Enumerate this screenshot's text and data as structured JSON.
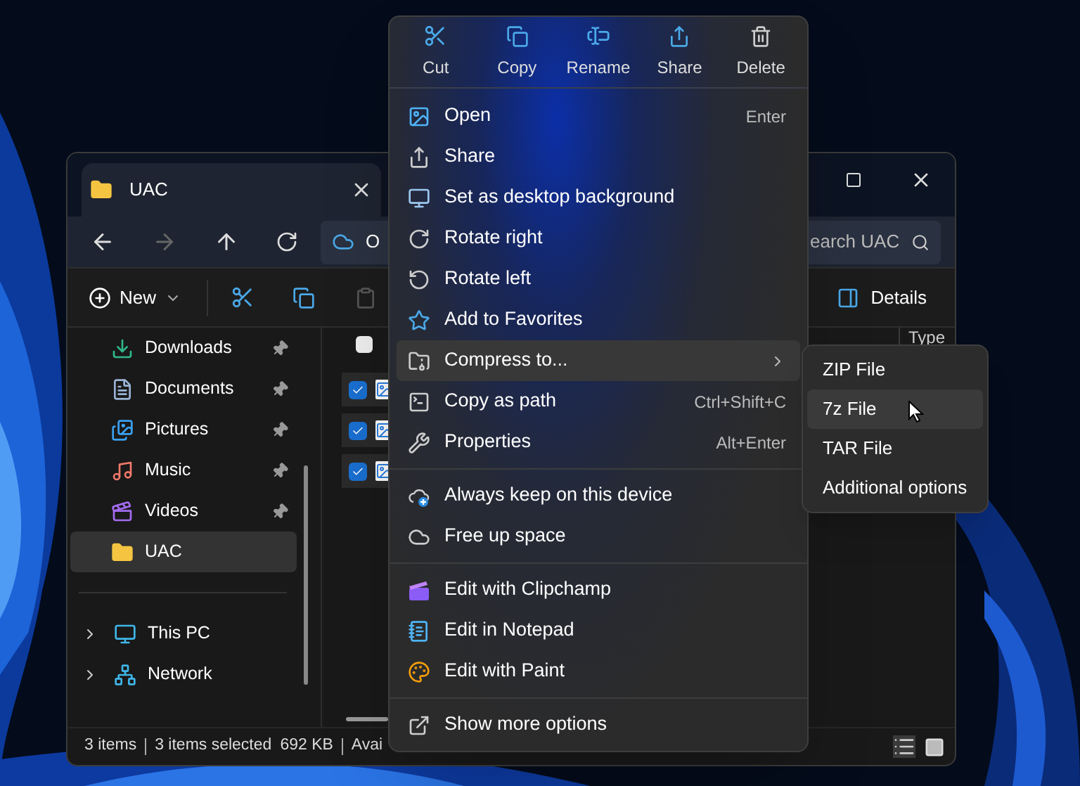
{
  "explorer": {
    "tab": {
      "title": "UAC"
    },
    "address": {
      "text": "O"
    },
    "search": {
      "placeholder": "earch UAC"
    },
    "toolbar": {
      "new_label": "New",
      "details_label": "Details"
    },
    "sidebar": {
      "items": [
        {
          "label": "Downloads",
          "pinned": true,
          "selected": false
        },
        {
          "label": "Documents",
          "pinned": true,
          "selected": false
        },
        {
          "label": "Pictures",
          "pinned": true,
          "selected": false
        },
        {
          "label": "Music",
          "pinned": true,
          "selected": false
        },
        {
          "label": "Videos",
          "pinned": true,
          "selected": false
        },
        {
          "label": "UAC",
          "pinned": false,
          "selected": true
        }
      ],
      "locations": [
        {
          "label": "This PC",
          "expanded": false
        },
        {
          "label": "Network",
          "expanded": false
        }
      ]
    },
    "file_list": {
      "header_checked": false,
      "column_type": "Type",
      "rows": [
        {
          "checked": true
        },
        {
          "checked": true
        },
        {
          "checked": true
        }
      ]
    },
    "status_bar": {
      "count": "3 items",
      "selection": "3 items selected",
      "size": "692 KB",
      "available": "Avai"
    }
  },
  "context_menu": {
    "actions": [
      {
        "label": "Cut"
      },
      {
        "label": "Copy"
      },
      {
        "label": "Rename"
      },
      {
        "label": "Share"
      },
      {
        "label": "Delete"
      }
    ],
    "groups": [
      {
        "items": [
          {
            "kind": "command",
            "label": "Open",
            "shortcut": "Enter",
            "selected": false
          },
          {
            "kind": "command",
            "label": "Share",
            "selected": false
          },
          {
            "kind": "command",
            "label": "Set as desktop background",
            "selected": false
          },
          {
            "kind": "command",
            "label": "Rotate right",
            "selected": false
          },
          {
            "kind": "command",
            "label": "Rotate left",
            "selected": false
          },
          {
            "kind": "command",
            "label": "Add to Favorites",
            "selected": false
          },
          {
            "kind": "submenu",
            "label": "Compress to...",
            "selected": true
          },
          {
            "kind": "command",
            "label": "Copy as path",
            "shortcut": "Ctrl+Shift+C",
            "selected": false
          },
          {
            "kind": "command",
            "label": "Properties",
            "shortcut": "Alt+Enter",
            "selected": false
          }
        ]
      },
      {
        "items": [
          {
            "kind": "command",
            "label": "Always keep on this device",
            "selected": false
          },
          {
            "kind": "command",
            "label": "Free up space",
            "selected": false
          }
        ]
      },
      {
        "items": [
          {
            "kind": "command",
            "label": "Edit with Clipchamp",
            "selected": false
          },
          {
            "kind": "command",
            "label": "Edit in Notepad",
            "selected": false
          },
          {
            "kind": "command",
            "label": "Edit with Paint",
            "selected": false
          }
        ]
      },
      {
        "items": [
          {
            "kind": "command",
            "label": "Show more options",
            "selected": false
          }
        ]
      }
    ]
  },
  "submenu": {
    "items": [
      {
        "label": "ZIP File",
        "selected": false
      },
      {
        "label": "7z File",
        "selected": true
      },
      {
        "label": "TAR File",
        "selected": false
      },
      {
        "label": "Additional options",
        "selected": false
      }
    ]
  }
}
